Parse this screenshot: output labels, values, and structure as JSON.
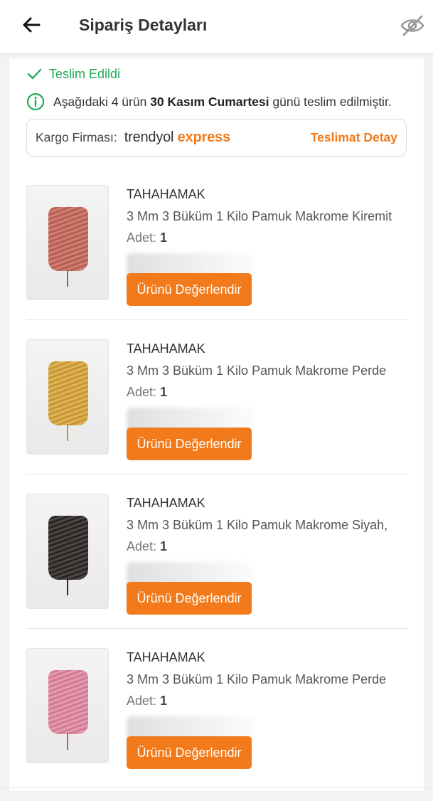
{
  "header": {
    "title": "Sipariş Detayları",
    "back_icon": "arrow-left-icon",
    "visibility_icon": "eye-off-icon"
  },
  "status": {
    "label": "Teslim Edildi",
    "icon": "check-icon",
    "color": "#1faa56"
  },
  "delivery_info": {
    "icon": "info-circle-icon",
    "prefix": "Aşağıdaki 4 ürün ",
    "date": "30 Kasım Cumartesi",
    "suffix": " günü teslim edilmiştir."
  },
  "cargo": {
    "label": "Kargo Firması:",
    "brand_part1": "trendyol",
    "brand_part2": "express",
    "link": "Teslimat Detay",
    "accent": "#f27a1a"
  },
  "products": [
    {
      "seller": "TAHAHAMAK",
      "name": "3 Mm 3 Büküm 1 Kilo Pamuk Makrome Kiremit",
      "qty_label": "Adet:",
      "qty": "1",
      "button": "Ürünü Değerlendir",
      "color": "#c96a5c"
    },
    {
      "seller": "TAHAHAMAK",
      "name": "3 Mm 3 Büküm 1 Kilo Pamuk Makrome  Perde",
      "qty_label": "Adet:",
      "qty": "1",
      "button": "Ürünü Değerlendir",
      "color": "#dba83a"
    },
    {
      "seller": "TAHAHAMAK",
      "name": "3 Mm 3 Büküm 1 Kilo Pamuk Makrome Siyah, ",
      "qty_label": "Adet:",
      "qty": "1",
      "button": "Ürünü Değerlendir",
      "color": "#2f2926"
    },
    {
      "seller": "TAHAHAMAK",
      "name": "3 Mm 3 Büküm 1 Kilo Pamuk Makrome  Perde",
      "qty_label": "Adet:",
      "qty": "1",
      "button": "Ürünü Değerlendir",
      "color": "#e58aa3"
    }
  ]
}
